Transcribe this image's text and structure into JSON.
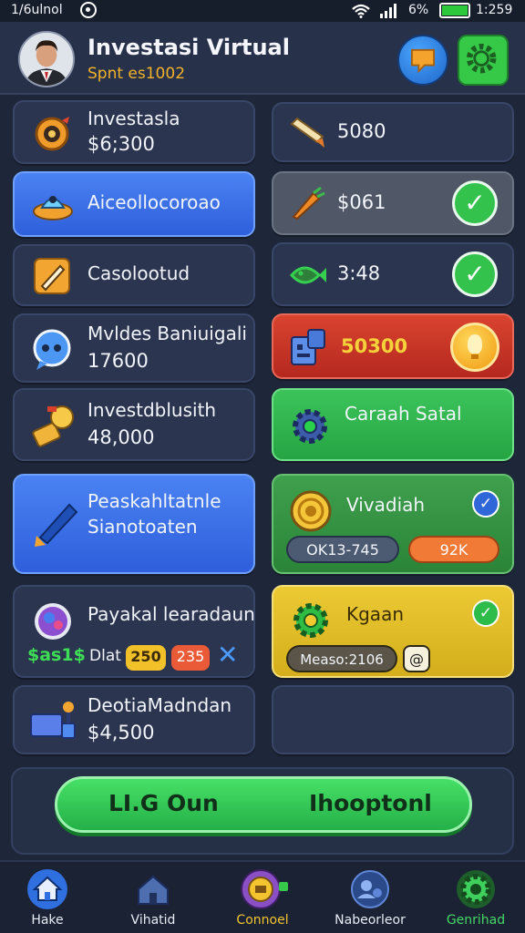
{
  "status_bar": {
    "carrier": "1/6ulnol",
    "battery_pct": "6%",
    "time": "1:259",
    "battery_level": 1.0
  },
  "header": {
    "title": "Investasi Virtual",
    "subtitle": "Spnt es1002",
    "chat_icon": "chat-icon",
    "settings_icon": "gear-icon"
  },
  "left_cards": [
    {
      "title": "Investasla",
      "value": "$6;300",
      "icon": "coin-target-icon"
    },
    {
      "title": "Aiceollocoroao",
      "value": "",
      "icon": "ufo-icon"
    },
    {
      "title": "Casolootud",
      "value": "",
      "icon": "pencil-icon"
    },
    {
      "title": "Mvldes Baniuigali",
      "value": "17600",
      "icon": "chat-bubble-icon"
    },
    {
      "title": "Investdblusith",
      "value": "48,000",
      "icon": "hammer-coin-icon"
    },
    {
      "title": "Peaskahltatnle",
      "value": "Sianotoaten",
      "icon": "blue-pen-icon"
    },
    {
      "title": "Payakal learadaun",
      "value": "",
      "icon": "planet-icon",
      "extras": {
        "money_tag": "$as1$",
        "label": "Dlat",
        "badge_yellow": "250",
        "badge_orange": "235",
        "close_icon": "close-icon"
      }
    },
    {
      "title": "DeotiaMadndan",
      "value": "$4,500",
      "icon": "card-joystick-icon"
    }
  ],
  "right_cards": [
    {
      "value": "5080",
      "icon": "scroll-icon"
    },
    {
      "value": "$061",
      "icon": "carrot-icon",
      "check": true
    },
    {
      "value": "3:48",
      "icon": "fish-icon",
      "check": true
    },
    {
      "value": "50300",
      "icon": "robot-icon",
      "lightbulb": true
    },
    {
      "title": "Caraah Satal",
      "icon": "cog-icon"
    },
    {
      "title": "Vivadiah",
      "icon": "gold-coin-icon",
      "pill_left": "OK13-745",
      "pill_right": "92K",
      "check": true
    },
    {
      "title": "Kgaan",
      "icon": "green-gear-icon",
      "pill_left": "Measo:2106",
      "pill_right": "@",
      "check": true
    },
    {
      "title": ""
    }
  ],
  "cta": {
    "left_label": "LI.G Oun",
    "right_label": "Ihooptonl"
  },
  "bottom_nav": [
    {
      "label": "Hake",
      "icon": "home-icon",
      "color": "#ffffff"
    },
    {
      "label": "Vihatid",
      "icon": "house-icon",
      "color": "#ffffff"
    },
    {
      "label": "Connoel",
      "icon": "coin-robot-icon",
      "color": "#f3c430"
    },
    {
      "label": "Nabeorleor",
      "icon": "globe-user-icon",
      "color": "#ffffff"
    },
    {
      "label": "Genrihad",
      "icon": "gear-icon",
      "color": "#45d866"
    }
  ]
}
